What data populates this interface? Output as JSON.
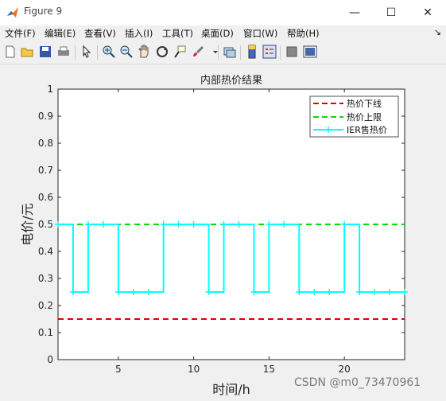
{
  "window": {
    "title": "Figure 9",
    "minimize_icon": "—",
    "maximize_icon": "☐",
    "close_icon": "✕"
  },
  "menu": [
    "文件(F)",
    "编辑(E)",
    "查看(V)",
    "插入(I)",
    "工具(T)",
    "桌面(D)",
    "窗口(W)",
    "帮助(H)"
  ],
  "menu_arrow": "↘",
  "toolbar_icons": [
    "new-figure-icon",
    "open-file-icon",
    "save-icon",
    "print-icon",
    "edit-plot-icon",
    "zoom-in-icon",
    "zoom-out-icon",
    "pan-icon",
    "rotate-icon",
    "data-cursor-icon",
    "brush-icon",
    "link-icon",
    "colorbar-icon",
    "legend-icon",
    "hide-plot-tools-icon",
    "show-plot-tools-icon"
  ],
  "watermark": "CSDN @m0_73470961",
  "chart_data": {
    "type": "line",
    "title": "内部热价结果",
    "xlabel": "时间/h",
    "ylabel": "电价/元",
    "xlim": [
      1,
      24
    ],
    "ylim": [
      0,
      1
    ],
    "xticks": [
      5,
      10,
      15,
      20
    ],
    "yticks": [
      0,
      0.1,
      0.2,
      0.3,
      0.4,
      0.5,
      0.6,
      0.7,
      0.8,
      0.9,
      1
    ],
    "legend_position": "top-right",
    "grid": false,
    "series": [
      {
        "name": "热价下线",
        "style": "dashed",
        "color": "#e00000",
        "x": [
          1,
          24
        ],
        "values": [
          0.15,
          0.15
        ]
      },
      {
        "name": "热价上限",
        "style": "dashed",
        "color": "#00dd00",
        "x": [
          1,
          24
        ],
        "values": [
          0.5,
          0.5
        ]
      },
      {
        "name": "IER售热价",
        "style": "stairs",
        "color": "#00ffff",
        "marker": "+",
        "x": [
          1,
          2,
          3,
          4,
          5,
          6,
          7,
          8,
          9,
          10,
          11,
          12,
          13,
          14,
          15,
          16,
          17,
          18,
          19,
          20,
          21,
          22,
          23,
          24
        ],
        "values": [
          0.5,
          0.25,
          0.5,
          0.5,
          0.25,
          0.25,
          0.25,
          0.5,
          0.5,
          0.5,
          0.25,
          0.5,
          0.5,
          0.25,
          0.5,
          0.5,
          0.25,
          0.25,
          0.25,
          0.5,
          0.25,
          0.25,
          0.25,
          0.25
        ]
      }
    ]
  }
}
